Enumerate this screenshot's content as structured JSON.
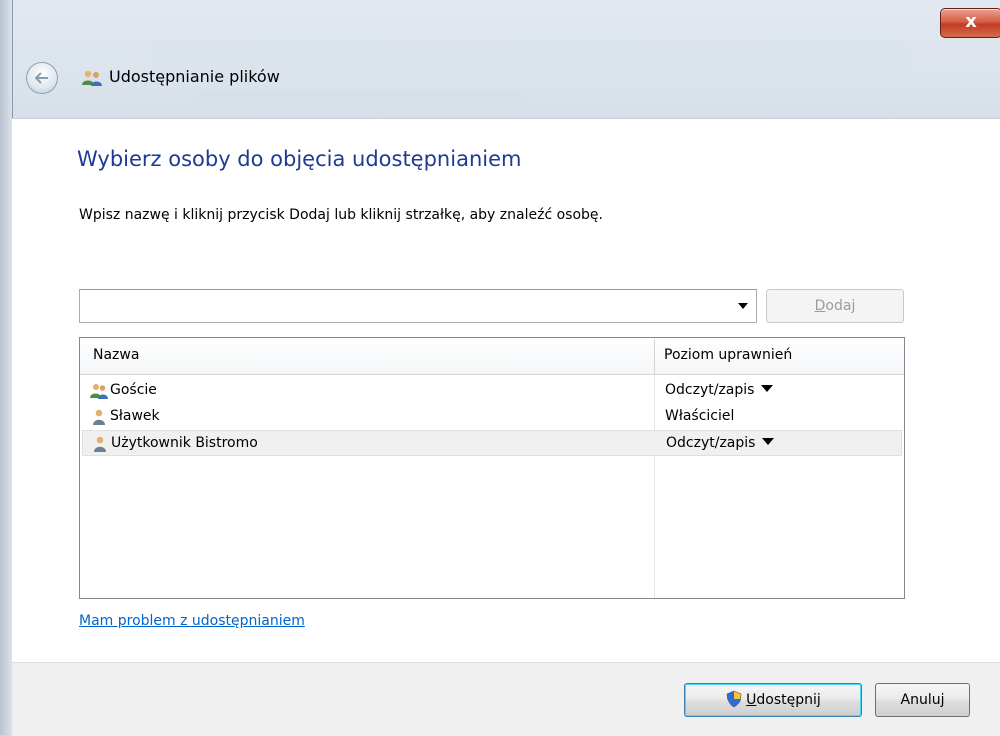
{
  "window": {
    "title": "Udostępnianie plików",
    "close_label": "x"
  },
  "main": {
    "heading": "Wybierz osoby do objęcia udostępnianiem",
    "instruction": "Wpisz nazwę i kliknij przycisk Dodaj lub kliknij strzałkę, aby znaleźć osobę.",
    "combo_value": "",
    "add_button": {
      "access_key": "D",
      "rest": "odaj"
    },
    "list": {
      "columns": [
        "Nazwa",
        "Poziom uprawnień"
      ],
      "rows": [
        {
          "name": "Goście",
          "permission": "Odczyt/zapis",
          "has_dropdown": true,
          "icon": "user-group-icon"
        },
        {
          "name": "Sławek",
          "permission": "Właściciel",
          "has_dropdown": false,
          "icon": "user-icon"
        },
        {
          "name": "Użytkownik Bistromo",
          "permission": "Odczyt/zapis",
          "has_dropdown": true,
          "icon": "user-icon",
          "selected": true
        }
      ]
    },
    "help_link": "Mam problem z udostępnianiem"
  },
  "footer": {
    "share_button": {
      "access_key": "U",
      "rest": "dostępnij"
    },
    "cancel_button": "Anuluj"
  },
  "colors": {
    "heading": "#1e3a94",
    "link": "#0066cc",
    "close_button": "#c13d22"
  }
}
